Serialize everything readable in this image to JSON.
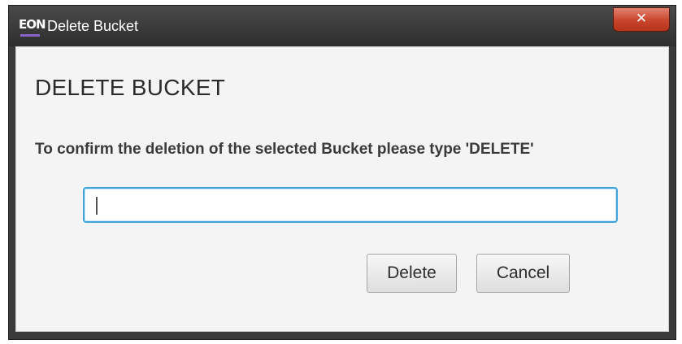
{
  "window": {
    "app_icon_text": "EON",
    "title": "Delete Bucket",
    "close_glyph": "✕"
  },
  "dialog": {
    "heading": "DELETE BUCKET",
    "message": "To confirm the deletion of the selected Bucket please type 'DELETE'",
    "input_value": "",
    "buttons": {
      "delete_label": "Delete",
      "cancel_label": "Cancel"
    }
  },
  "colors": {
    "close_button": "#c8442c",
    "input_focus_border": "#3ea4dc",
    "logo_underline": "#8a63c8"
  },
  "icons": {
    "app": "eon-logo-icon",
    "close": "close-icon"
  }
}
